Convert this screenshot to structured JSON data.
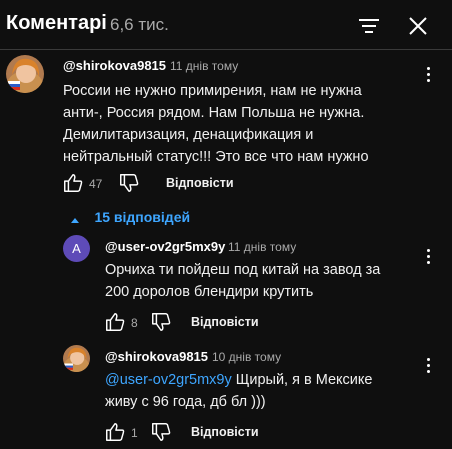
{
  "header": {
    "title": "Коментарі",
    "count": "6,6 тис."
  },
  "comments": [
    {
      "author": "@shirokova9815",
      "time": "11 днів тому",
      "lines": [
        "России не нужно примирения, нам не нужна",
        "анти-, Россия рядом. Нам Польша не нужна.",
        "Демилитаризация, денацификация и",
        "нейтральный статус!!! Это все что нам нужно"
      ],
      "likes": "47",
      "reply_label": "Відповісти"
    }
  ],
  "replies_toggle": {
    "label": "15 відповідей"
  },
  "replies": [
    {
      "avatar_letter": "A",
      "author": "@user-ov2gr5mx9y",
      "time": "11 днів тому",
      "lines": [
        "Орчиха ти пойдеш под китай на завод за",
        "200 доролов блендири крутить"
      ],
      "likes": "8",
      "reply_label": "Відповісти"
    },
    {
      "author": "@shirokova9815",
      "time": "10 днів тому",
      "mention": "@user-ov2gr5mx9y",
      "line1_rest": " Щирый, я в Мексике",
      "line2": "живу с 96 года, дб бл )))",
      "likes": "1",
      "reply_label": "Відповісти"
    }
  ],
  "colors": {
    "background": "#0f0f0f",
    "link": "#3ea6ff",
    "secondary_text": "#aaaaaa",
    "letter_avatar": "#5e4bb8"
  }
}
